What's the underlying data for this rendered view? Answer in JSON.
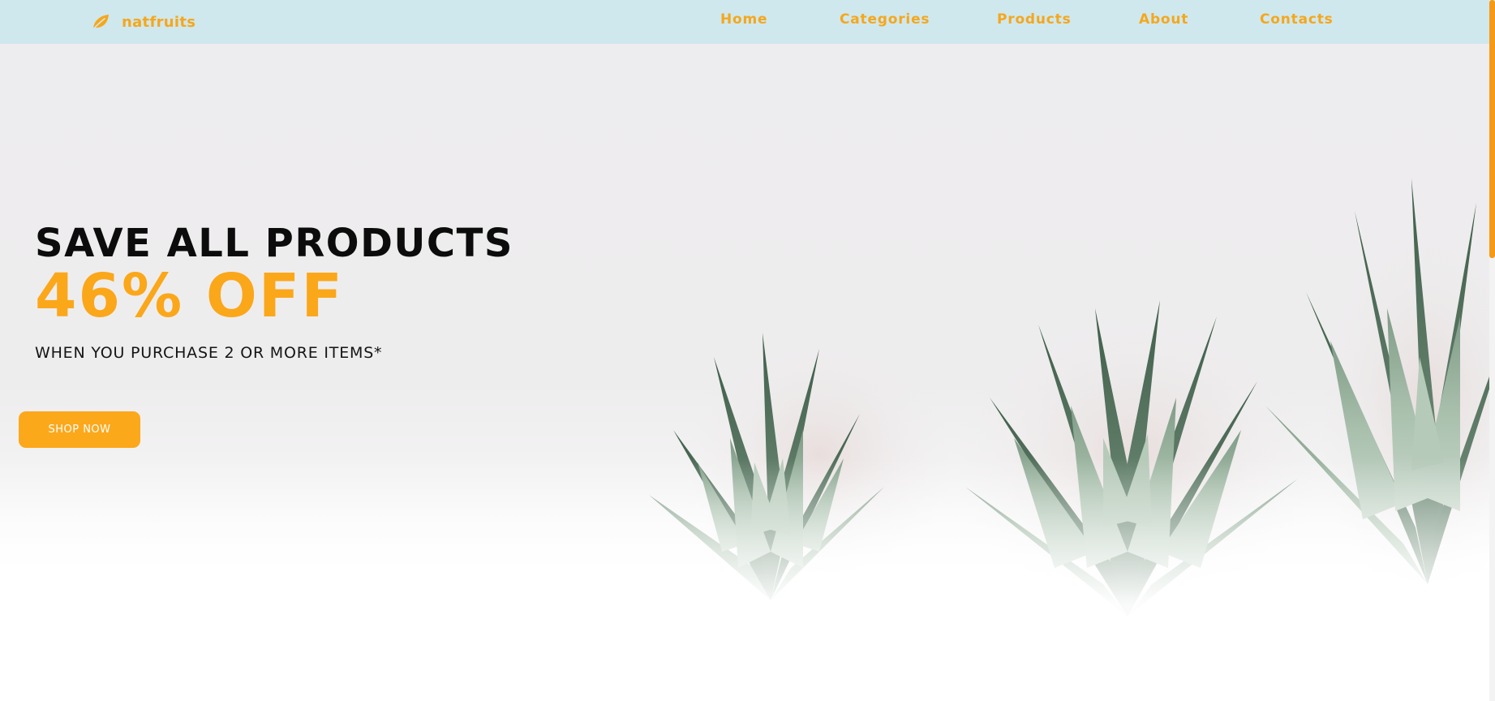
{
  "brand": {
    "name": "natfruits",
    "icon": "leaf-icon"
  },
  "nav": [
    {
      "label": "Home"
    },
    {
      "label": "Categories"
    },
    {
      "label": "Products"
    },
    {
      "label": "About"
    },
    {
      "label": "Contacts"
    }
  ],
  "hero": {
    "headline": "SAVE ALL PRODUCTS",
    "discount": "46% OFF",
    "subline": "WHEN YOU PURCHASE 2 OR MORE ITEMS*",
    "cta_label": "SHOP NOW"
  },
  "colors": {
    "accent": "#f5a71c",
    "topbar": "#cfe8ee",
    "headline": "#0c0c0c",
    "scrollbar_thumb": "#f49a18"
  }
}
